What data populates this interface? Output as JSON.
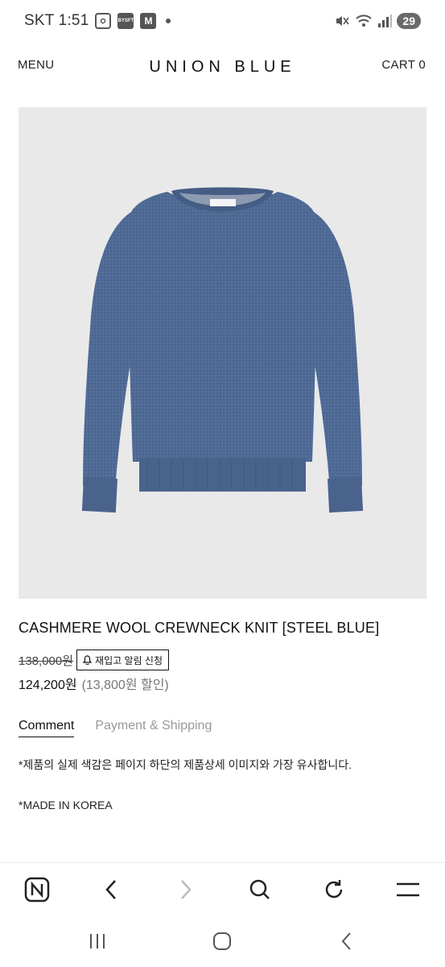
{
  "status_bar": {
    "carrier_time": "SKT 1:51",
    "icon_badge_1": "BYSFT",
    "icon_badge_2": "M",
    "battery": "29"
  },
  "header": {
    "menu": "MENU",
    "brand": "UNION BLUE",
    "cart": "CART 0"
  },
  "product": {
    "image_alt": "steel blue cashmere wool crewneck sweater",
    "image_bg": "#e9e9e9",
    "sweater_color": "#4f6a95",
    "title": "CASHMERE WOOL CREWNECK KNIT [STEEL BLUE]",
    "original_price": "138,000원",
    "restock_button": "재입고 알림 신청",
    "sale_price": "124,200원",
    "discount": "(13,800원 할인)"
  },
  "tabs": [
    {
      "label": "Comment",
      "active": true
    },
    {
      "label": "Payment & Shipping",
      "active": false
    }
  ],
  "description": {
    "line1": "*제품의 실제 색감은 페이지 하단의 제품상세 이미지와 가장 유사합니다.",
    "line2": "*MADE IN KOREA"
  },
  "browser_toolbar": {
    "icons": [
      "naver-icon",
      "back-icon",
      "forward-icon",
      "search-icon",
      "refresh-icon",
      "menu-icon"
    ]
  },
  "system_nav": {
    "icons": [
      "recent-apps-icon",
      "home-icon",
      "back-icon"
    ]
  }
}
